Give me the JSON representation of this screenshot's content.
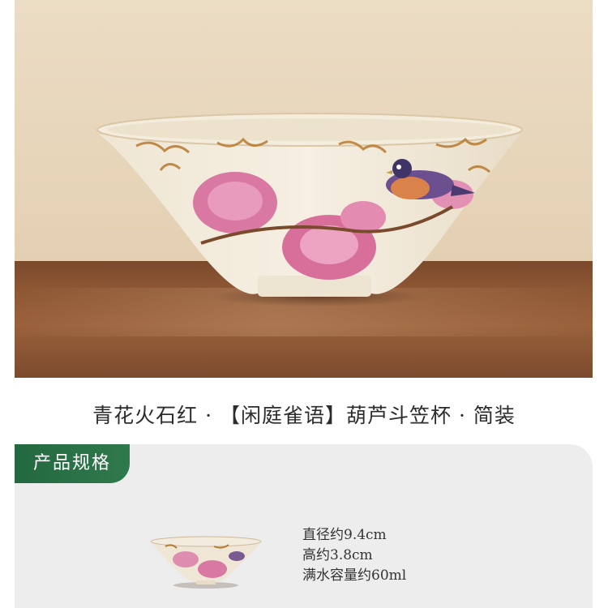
{
  "product": {
    "title": "青花火石红 · 【闲庭雀语】葫芦斗笠杯 · 简装"
  },
  "spec_section": {
    "heading": "产品规格",
    "specs": [
      "直径约9.4cm",
      "高约3.8cm",
      "满水容量约60ml"
    ]
  },
  "colors": {
    "accent_green": "#2a7046",
    "panel_gray": "#ededed",
    "wall_beige": "#e8d8be",
    "table_wood": "#8e5734"
  },
  "icons": {
    "hero_image": "tea-cup-photo",
    "thumbnail": "tea-cup-thumbnail"
  }
}
